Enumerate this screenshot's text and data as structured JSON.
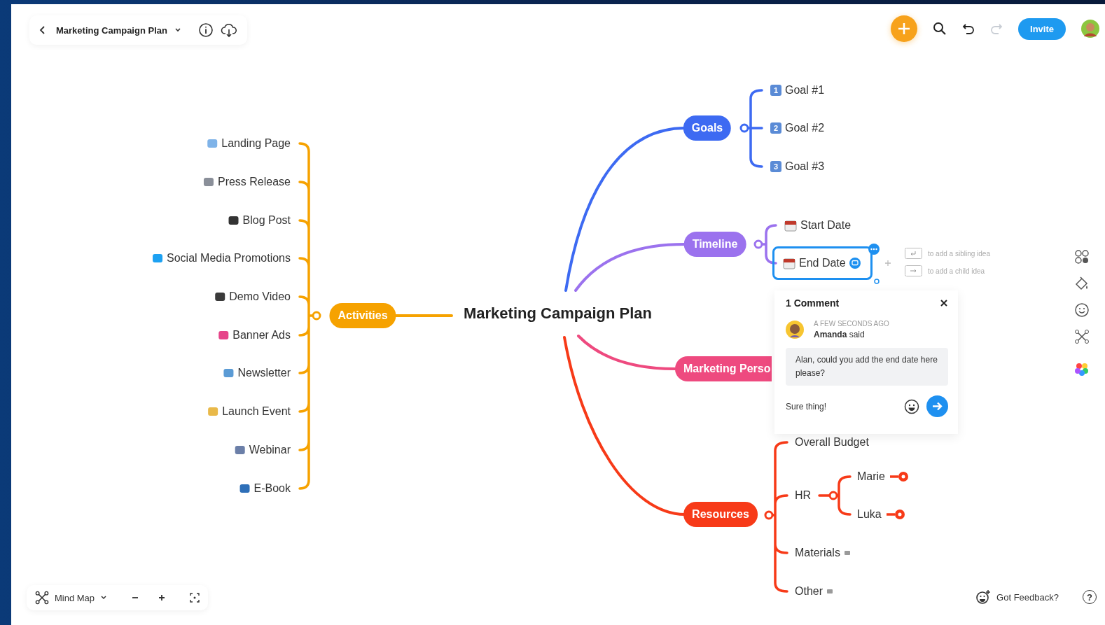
{
  "topbar": {
    "title": "Marketing Campaign Plan",
    "invite": "Invite"
  },
  "central_topic": "Marketing Campaign Plan",
  "branches": [
    {
      "label": "Activities",
      "color": "#f6a200",
      "children": [
        {
          "label": "Landing Page"
        },
        {
          "label": "Press Release"
        },
        {
          "label": "Blog Post"
        },
        {
          "label": "Social Media Promotions"
        },
        {
          "label": "Demo Video"
        },
        {
          "label": "Banner Ads"
        },
        {
          "label": "Newsletter"
        },
        {
          "label": "Launch Event"
        },
        {
          "label": "Webinar"
        },
        {
          "label": "E-Book"
        }
      ]
    },
    {
      "label": "Goals",
      "color": "#3d6af2",
      "children": [
        {
          "label": "Goal #1",
          "badge": "1"
        },
        {
          "label": "Goal #2",
          "badge": "2"
        },
        {
          "label": "Goal #3",
          "badge": "3"
        }
      ]
    },
    {
      "label": "Timeline",
      "color": "#9b72ee",
      "children": [
        {
          "label": "Start Date",
          "selected": false,
          "has_comment": false
        },
        {
          "label": "End Date",
          "selected": true,
          "has_comment": true
        }
      ]
    },
    {
      "label": "Marketing Perso",
      "color": "#ee4a7f"
    },
    {
      "label": "Resources",
      "color": "#f73a18",
      "children": [
        {
          "label": "Overall Budget",
          "note": false
        },
        {
          "label": "HR",
          "note": false,
          "children": [
            {
              "label": "Marie",
              "collapsed": true
            },
            {
              "label": "Luka",
              "collapsed": true
            }
          ]
        },
        {
          "label": "Materials",
          "note": true
        },
        {
          "label": "Other",
          "note": true
        }
      ]
    }
  ],
  "hints": [
    "to add a sibling idea",
    "to add a child idea"
  ],
  "comment_panel": {
    "title": "1 Comment",
    "time": "A FEW SECONDS AGO",
    "author_line": "**Amanda** said",
    "message": "Alan, could you add the end date here please?",
    "reply": "Sure thing!"
  },
  "bottom_bar": {
    "view": "Mind Map"
  },
  "feedback": "Got Feedback?",
  "help": "?"
}
